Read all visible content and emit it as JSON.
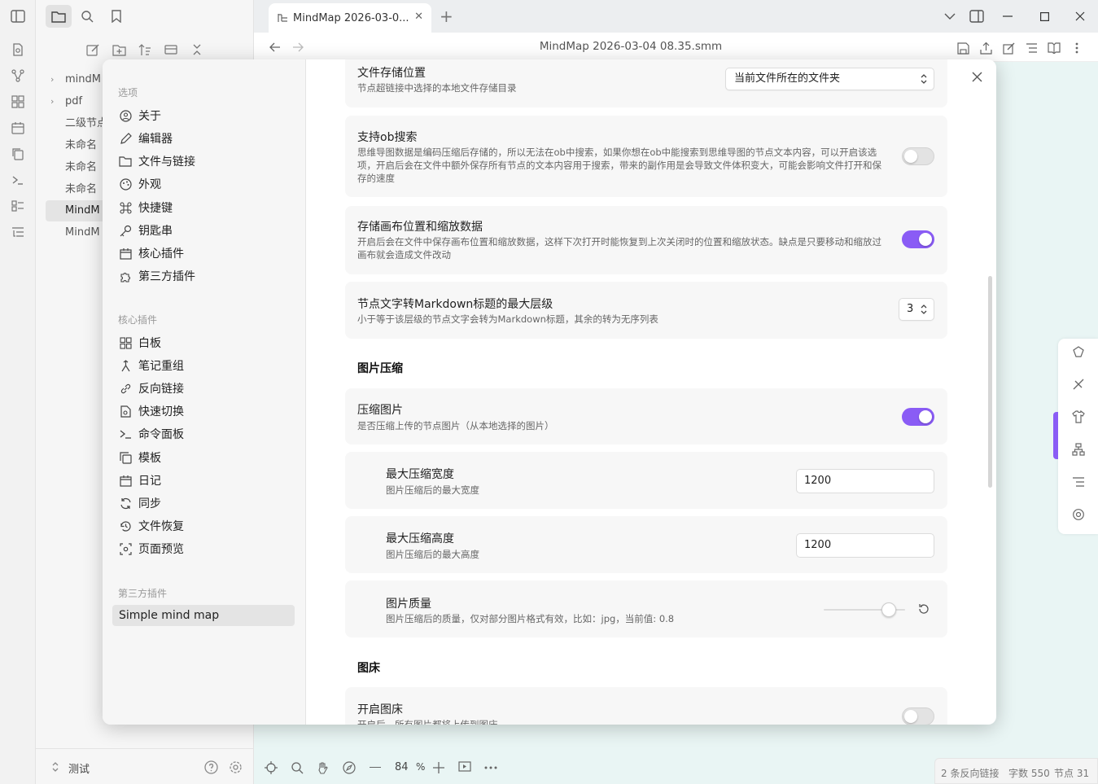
{
  "tab": {
    "title": "MindMap 2026-03-0...",
    "close": "✕",
    "new": "+"
  },
  "nav": {
    "file_title": "MindMap 2026-03-04 08.35.smm"
  },
  "tree": {
    "items": [
      {
        "label": "mindM",
        "folder": true,
        "chevron": "›"
      },
      {
        "label": "pdf",
        "folder": true,
        "chevron": "›"
      },
      {
        "label": "二级节点"
      },
      {
        "label": "未命名"
      },
      {
        "label": "未命名"
      },
      {
        "label": "未命名"
      },
      {
        "label": "MindM",
        "active": true
      },
      {
        "label": "MindM"
      }
    ],
    "vault_name": "测试"
  },
  "status": {
    "zoom": "84",
    "zoom_unit": "%",
    "backlinks": "2 条反向链接",
    "word_count": "字数 550",
    "node_count": "节点 31"
  },
  "modal": {
    "close": "✕",
    "sidebar": {
      "options_head": "选项",
      "options": [
        {
          "label": "关于",
          "icon": "info-circle-icon"
        },
        {
          "label": "编辑器",
          "icon": "pencil-icon"
        },
        {
          "label": "文件与链接",
          "icon": "folder-link-icon"
        },
        {
          "label": "外观",
          "icon": "palette-icon"
        },
        {
          "label": "快捷键",
          "icon": "command-icon"
        },
        {
          "label": "钥匙串",
          "icon": "key-icon"
        },
        {
          "label": "核心插件",
          "icon": "calendar-plugin-icon"
        },
        {
          "label": "第三方插件",
          "icon": "puzzle-icon"
        }
      ],
      "core_head": "核心插件",
      "core": [
        {
          "label": "白板",
          "icon": "grid-icon"
        },
        {
          "label": "笔记重组",
          "icon": "merge-icon"
        },
        {
          "label": "反向链接",
          "icon": "backlink-icon"
        },
        {
          "label": "快速切换",
          "icon": "file-switch-icon"
        },
        {
          "label": "命令面板",
          "icon": "terminal-icon"
        },
        {
          "label": "模板",
          "icon": "copy-icon"
        },
        {
          "label": "日记",
          "icon": "calendar-icon"
        },
        {
          "label": "同步",
          "icon": "sync-icon"
        },
        {
          "label": "文件恢复",
          "icon": "history-icon"
        },
        {
          "label": "页面预览",
          "icon": "scan-eye-icon"
        }
      ],
      "third_head": "第三方插件",
      "third": [
        {
          "label": "Simple mind map",
          "active": true
        }
      ]
    },
    "settings": {
      "storage": {
        "name": "文件存储位置",
        "desc": "节点超链接中选择的本地文件存储目录",
        "value": "当前文件所在的文件夹"
      },
      "ob_search": {
        "name": "支持ob搜索",
        "desc": "思维导图数据是编码压缩后存储的，所以无法在ob中搜索，如果你想在ob中能搜索到思维导图的节点文本内容，可以开启该选项，开启后会在文件中额外保存所有节点的文本内容用于搜索，带来的副作用是会导致文件体积变大，可能会影响文件打开和保存的速度",
        "on": false
      },
      "canvas_pos": {
        "name": "存储画布位置和缩放数据",
        "desc": "开启后会在文件中保存画布位置和缩放数据，这样下次打开时能恢复到上次关闭时的位置和缩放状态。缺点是只要移动和缩放过画布就会造成文件改动",
        "on": true
      },
      "md_level": {
        "name": "节点文字转Markdown标题的最大层级",
        "desc": "小于等于该层级的节点文字会转为Markdown标题，其余的转为无序列表",
        "value": "3"
      },
      "img_section": "图片压缩",
      "compress": {
        "name": "压缩图片",
        "desc": "是否压缩上传的节点图片（从本地选择的图片）",
        "on": true
      },
      "max_width": {
        "name": "最大压缩宽度",
        "desc": "图片压缩后的最大宽度",
        "value": "1200"
      },
      "max_height": {
        "name": "最大压缩高度",
        "desc": "图片压缩后的最大高度",
        "value": "1200"
      },
      "quality": {
        "name": "图片质量",
        "desc": "图片压缩后的质量，仅对部分图片格式有效，比如：jpg，当前值: 0.8",
        "value": 0.8
      },
      "bed_section": "图床",
      "bed": {
        "name": "开启图床",
        "desc": "开启后，所有图片都将上传到图床",
        "on": false
      }
    }
  }
}
